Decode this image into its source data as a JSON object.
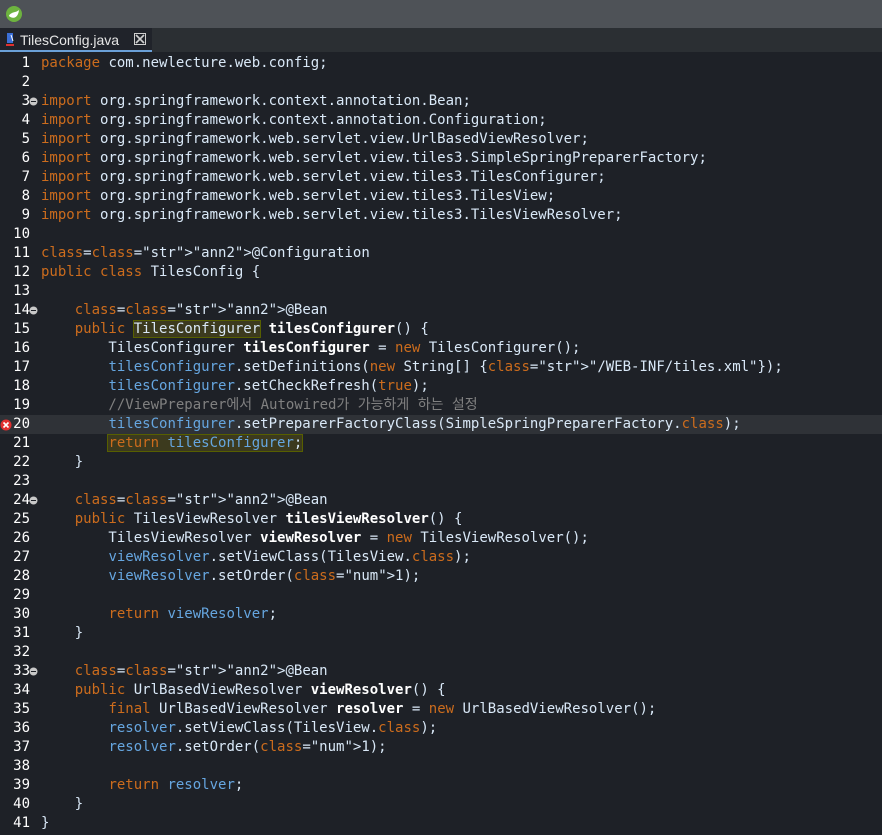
{
  "tab": {
    "title": "TilesConfig.java"
  },
  "code_lines": [
    "package com.newlecture.web.config;",
    "",
    "import org.springframework.context.annotation.Bean;",
    "import org.springframework.context.annotation.Configuration;",
    "import org.springframework.web.servlet.view.UrlBasedViewResolver;",
    "import org.springframework.web.servlet.view.tiles3.SimpleSpringPreparerFactory;",
    "import org.springframework.web.servlet.view.tiles3.TilesConfigurer;",
    "import org.springframework.web.servlet.view.tiles3.TilesView;",
    "import org.springframework.web.servlet.view.tiles3.TilesViewResolver;",
    "",
    "@Configuration",
    "public class TilesConfig {",
    "",
    "    @Bean",
    "    public TilesConfigurer tilesConfigurer() {",
    "        TilesConfigurer tilesConfigurer = new TilesConfigurer();",
    "        tilesConfigurer.setDefinitions(new String[] {\"/WEB-INF/tiles.xml\"});",
    "        tilesConfigurer.setCheckRefresh(true);",
    "        //ViewPreparer에서 Autowired가 가능하게 하는 설정",
    "        tilesConfigurer.setPreparerFactoryClass(SimpleSpringPreparerFactory.class);",
    "        return tilesConfigurer;",
    "    }",
    "",
    "    @Bean",
    "    public TilesViewResolver tilesViewResolver() {",
    "        TilesViewResolver viewResolver = new TilesViewResolver();",
    "        viewResolver.setViewClass(TilesView.class);",
    "        viewResolver.setOrder(1);",
    "",
    "        return viewResolver;",
    "    }",
    "",
    "    @Bean",
    "    public UrlBasedViewResolver viewResolver() {",
    "        final UrlBasedViewResolver resolver = new UrlBasedViewResolver();",
    "        resolver.setViewClass(TilesView.class);",
    "        resolver.setOrder(1);",
    "",
    "        return resolver;",
    "    }",
    "}"
  ]
}
